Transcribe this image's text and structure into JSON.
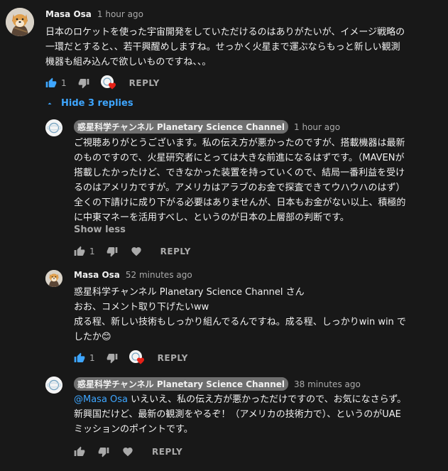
{
  "comment": {
    "author": "Masa Osa",
    "time": "1 hour ago",
    "lines": [
      "日本のロケットを使った宇宙開発をしていただけるのはありがたいが、イメージ戦略の",
      "一環だとすると、、若干興醒めしますね。せっかく火星まで運ぶならもっと新しい観測",
      "機器も組み込んで欲しいものですね、、。"
    ],
    "likes": "1",
    "reply_label": "REPLY"
  },
  "hide_replies_label": "Hide 3 replies",
  "replies": [
    {
      "author": "惑星科学チャンネル Planetary Science Channel",
      "time": "1 hour ago",
      "lines": [
        "ご視聴ありがとうございます。私の伝え方が悪かったのですが、搭載機器は最新",
        "のものですので、火星研究者にとっては大きな前進になるはずです。（MAVENが",
        "搭載したかったけど、できなかった装置を持っていくので、結局一番利益を受け",
        "るのはアメリカですが。アメリカはアラブのお金で探査できてウハウハのはず）",
        "全くの下請けに成り下がる必要はありませんが、日本もお金がない以上、積極的",
        "に中東マネーを活用すべし、というのが日本の上層部の判断です。"
      ],
      "show_less": "Show less",
      "likes": "1",
      "reply_label": "REPLY"
    },
    {
      "author": "Masa Osa",
      "time": "52 minutes ago",
      "lines": [
        "惑星科学チャンネル Planetary Science Channel さん",
        "おお、コメント取り下げたいww",
        "成る程、新しい技術もしっかり組んでるんですね。成る程、しっかりwin win で",
        "したか😊"
      ],
      "likes": "1",
      "reply_label": "REPLY"
    },
    {
      "author": "惑星科学チャンネル Planetary Science Channel",
      "time": "38 minutes ago",
      "mention": "@Masa Osa",
      "line1_rest": " いえいえ、私の伝え方が悪かっただけですので、お気になさらず。",
      "lines": [
        "新興国だけど、最新の観測をやるぞ！（アメリカの技術力で）、というのがUAE",
        "ミッションのポイントです。"
      ],
      "reply_label": "REPLY"
    }
  ],
  "colors": {
    "background": "#181818",
    "text": "#f1f1f1",
    "secondary": "#aaaaaa",
    "link": "#3ea6ff",
    "heart": "#e62117"
  }
}
